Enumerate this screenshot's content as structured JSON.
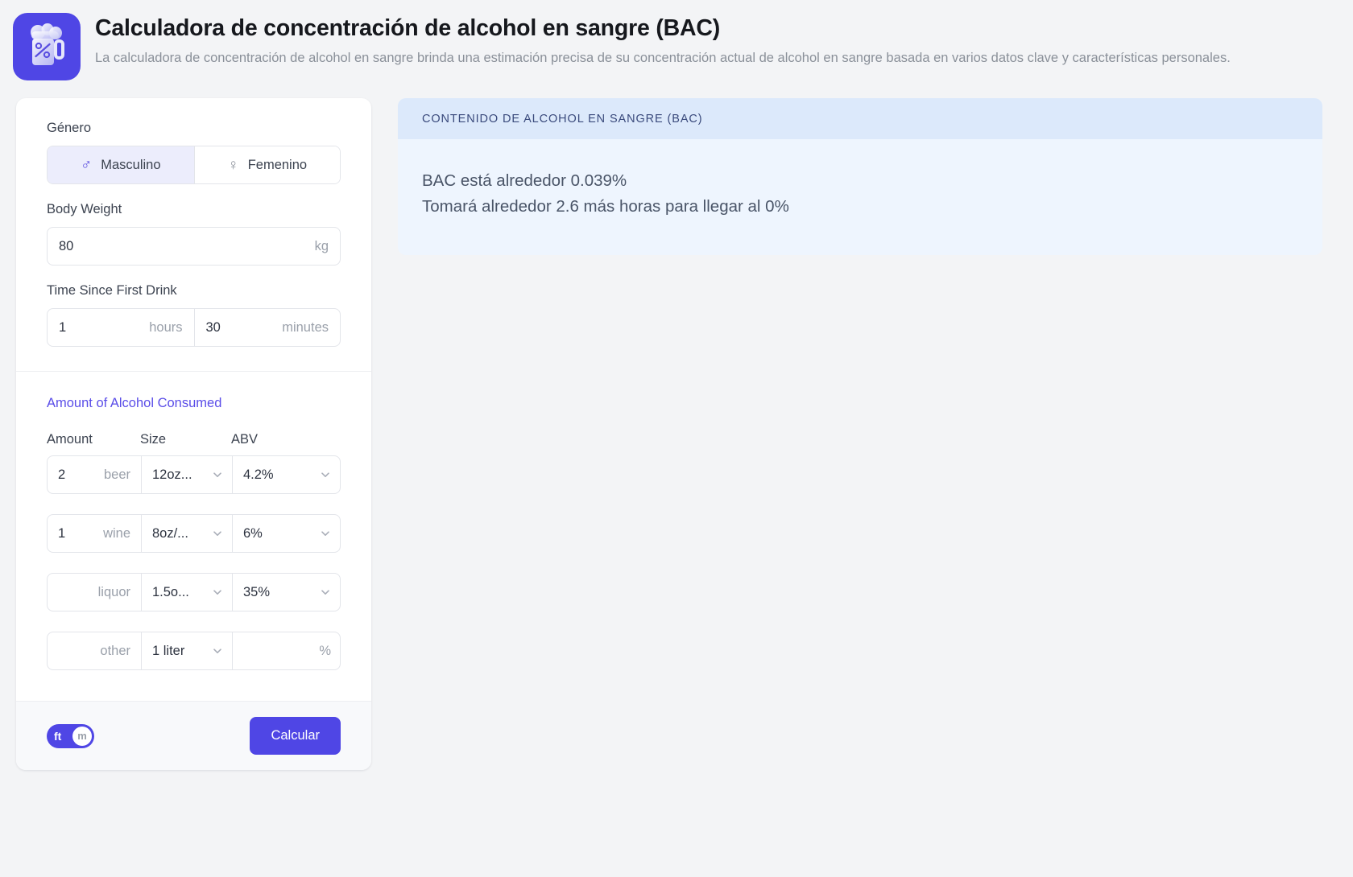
{
  "header": {
    "icon": "beer-mug-percent-icon",
    "title": "Calculadora de concentración de alcohol en sangre (BAC)",
    "description": "La calculadora de concentración de alcohol en sangre brinda una estimación precisa de su concentración actual de alcohol en sangre basada en varios datos clave y características personales."
  },
  "form": {
    "gender": {
      "label": "Género",
      "options": [
        {
          "label": "Masculino",
          "icon": "male-symbol-icon",
          "glyph": "♂",
          "selected": true
        },
        {
          "label": "Femenino",
          "icon": "female-symbol-icon",
          "glyph": "♀",
          "selected": false
        }
      ]
    },
    "body_weight": {
      "label": "Body Weight",
      "value": "80",
      "unit": "kg"
    },
    "time_since_first_drink": {
      "label": "Time Since First Drink",
      "hours_value": "1",
      "hours_unit": "hours",
      "minutes_value": "30",
      "minutes_unit": "minutes"
    },
    "alcohol": {
      "section_label": "Amount of Alcohol Consumed",
      "columns": [
        "Amount",
        "Size",
        "ABV"
      ],
      "rows": [
        {
          "amount": "2",
          "type": "beer",
          "size": "12oz...",
          "abv": "4.2%",
          "abv_suffix": ""
        },
        {
          "amount": "1",
          "type": "wine",
          "size": "8oz/...",
          "abv": "6%",
          "abv_suffix": ""
        },
        {
          "amount": "",
          "type": "liquor",
          "size": "1.5o...",
          "abv": "35%",
          "abv_suffix": ""
        },
        {
          "amount": "",
          "type": "other",
          "size": "1 liter",
          "abv": "",
          "abv_suffix": "%"
        }
      ]
    }
  },
  "footer": {
    "unit_toggle": {
      "left": "ft",
      "right": "m",
      "active": "m"
    },
    "calculate_label": "Calcular"
  },
  "result": {
    "header": "CONTENIDO DE ALCOHOL EN SANGRE (BAC)",
    "line1": "BAC está alrededor 0.039%",
    "line2": "Tomará alrededor 2.6 más horas para llegar al 0%"
  },
  "colors": {
    "accent": "#4f46e5",
    "accent_soft": "#ecedfc",
    "result_header_bg": "#dce9fb",
    "result_body_bg": "#eef5fe",
    "page_bg": "#f3f4f6"
  }
}
